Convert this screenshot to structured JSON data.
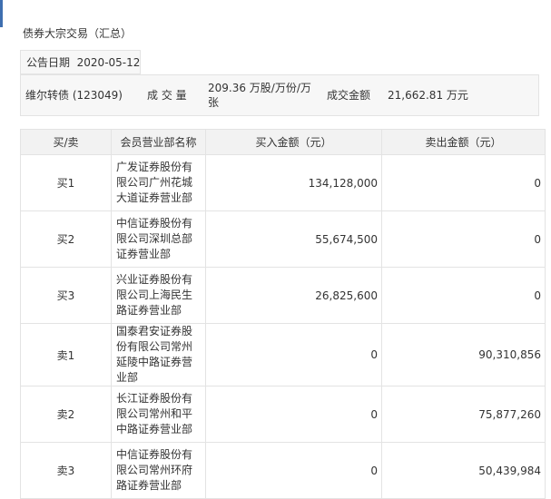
{
  "section_title": "债券大宗交易（汇总）",
  "announcement": {
    "label": "公告日期",
    "date": "2020-05-12"
  },
  "summary": {
    "bond_name": "维尔转债 (123049)",
    "volume_label": "成 交 量",
    "volume_value": "209.36 万股/万份/万张",
    "amount_label": "成交金额",
    "amount_value": "21,662.81 万元"
  },
  "table": {
    "headers": [
      "买/卖",
      "会员营业部名称",
      "买入金额（元）",
      "卖出金额（元）"
    ],
    "rows": [
      {
        "side": "买1",
        "branch": "广发证券股份有限公司广州花城大道证券营业部",
        "buy": "134,128,000",
        "sell": "0"
      },
      {
        "side": "买2",
        "branch": "中信证券股份有限公司深圳总部证券营业部",
        "buy": "55,674,500",
        "sell": "0"
      },
      {
        "side": "买3",
        "branch": "兴业证券股份有限公司上海民生路证券营业部",
        "buy": "26,825,600",
        "sell": "0"
      },
      {
        "side": "卖1",
        "branch": "国泰君安证券股份有限公司常州延陵中路证券营业部",
        "buy": "0",
        "sell": "90,310,856"
      },
      {
        "side": "卖2",
        "branch": "长江证券股份有限公司常州和平中路证券营业部",
        "buy": "0",
        "sell": "75,877,260"
      },
      {
        "side": "卖3",
        "branch": "中信证券股份有限公司常州环府路证券营业部",
        "buy": "0",
        "sell": "50,439,984"
      }
    ]
  }
}
